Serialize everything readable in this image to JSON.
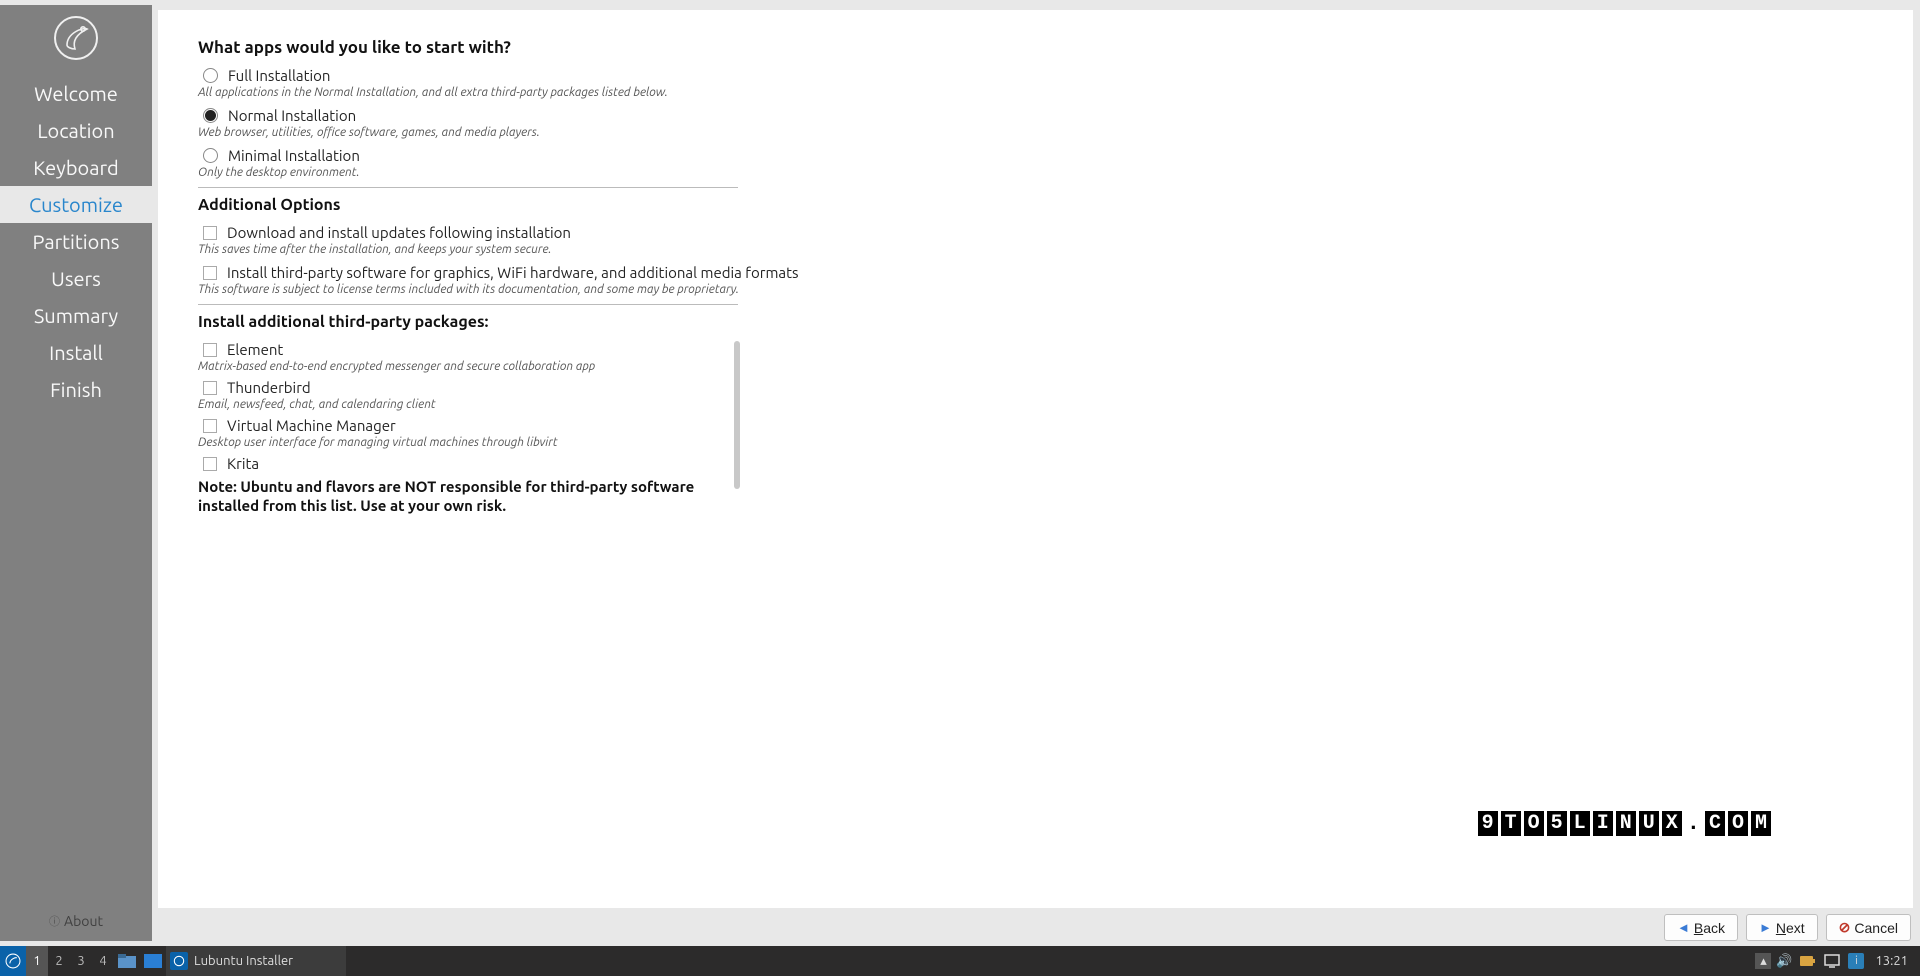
{
  "sidebar": {
    "steps": [
      "Welcome",
      "Location",
      "Keyboard",
      "Customize",
      "Partitions",
      "Users",
      "Summary",
      "Install",
      "Finish"
    ],
    "active_index": 3,
    "about": "About"
  },
  "headings": {
    "apps": "What apps would you like to start with?",
    "additional": "Additional Options",
    "third_party": "Install additional third-party packages:"
  },
  "install_modes": [
    {
      "label": "Full Installation",
      "desc": "All applications in the Normal Installation, and all extra third-party packages listed below.",
      "selected": false
    },
    {
      "label": "Normal Installation",
      "desc": "Web browser, utilities, office software, games, and media players.",
      "selected": true
    },
    {
      "label": "Minimal Installation",
      "desc": "Only the desktop environment.",
      "selected": false
    }
  ],
  "additional_options": [
    {
      "label": "Download and install updates following installation",
      "desc": "This saves time after the installation, and keeps your system secure.",
      "checked": false
    },
    {
      "label": "Install third-party software for graphics, WiFi hardware, and additional media formats",
      "desc": "This software is subject to license terms included with its documentation, and some may be proprietary.",
      "checked": false
    }
  ],
  "packages": [
    {
      "label": "Element",
      "desc": "Matrix-based end-to-end encrypted messenger and secure collaboration app",
      "checked": false
    },
    {
      "label": "Thunderbird",
      "desc": "Email, newsfeed, chat, and calendaring client",
      "checked": false
    },
    {
      "label": "Virtual Machine Manager",
      "desc": "Desktop user interface for managing virtual machines through libvirt",
      "checked": false
    },
    {
      "label": "Krita",
      "desc": "",
      "checked": false
    }
  ],
  "note": "Note: Ubuntu and flavors are NOT responsible for third-party software installed from this list. Use at your own risk.",
  "watermark": "9TO5LINUX.COM",
  "buttons": {
    "back": "Back",
    "next": "Next",
    "cancel": "Cancel"
  },
  "taskbar": {
    "workspaces": [
      "1",
      "2",
      "3",
      "4"
    ],
    "active_ws": 0,
    "window_title": "Lubuntu Installer",
    "clock": "13:21"
  }
}
